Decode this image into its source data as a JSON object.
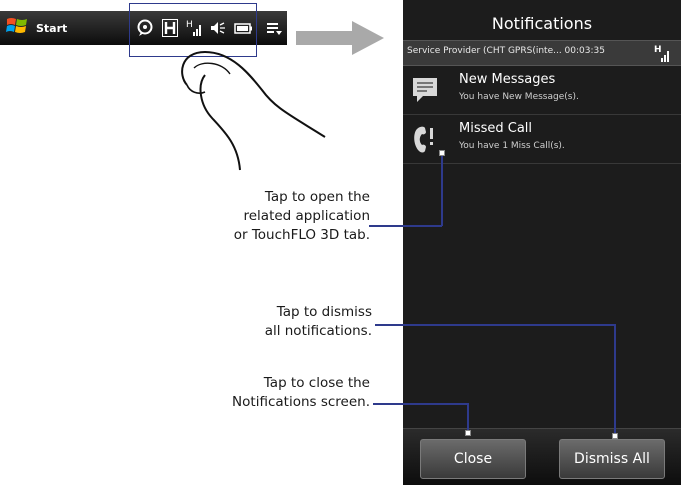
{
  "taskbar": {
    "start_label": "Start",
    "icons": [
      "windows-logo-icon",
      "notification-bubble-icon",
      "hsdpa-icon",
      "signal-icon",
      "volume-icon",
      "battery-icon",
      "menu-icon"
    ]
  },
  "phone": {
    "title": "Notifications",
    "provider_text": "Service Provider (CHT GPRS(inte... 00:03:35",
    "signal_label": "H",
    "notifications": [
      {
        "title": "New Messages",
        "subtitle": "You have New Message(s).",
        "icon": "message-icon"
      },
      {
        "title": "Missed Call",
        "subtitle": "You have 1 Miss Call(s).",
        "icon": "missed-call-icon"
      }
    ],
    "close_label": "Close",
    "dismiss_label": "Dismiss All"
  },
  "callouts": {
    "open_app": [
      "Tap to open the",
      "related application",
      "or TouchFLO 3D tab."
    ],
    "dismiss": [
      "Tap to dismiss",
      "all notifications."
    ],
    "close": [
      "Tap to close the",
      "Notifications screen."
    ]
  },
  "colors": {
    "accent_line": "#2e3a8c",
    "phone_bg": "#1c1c1c"
  }
}
